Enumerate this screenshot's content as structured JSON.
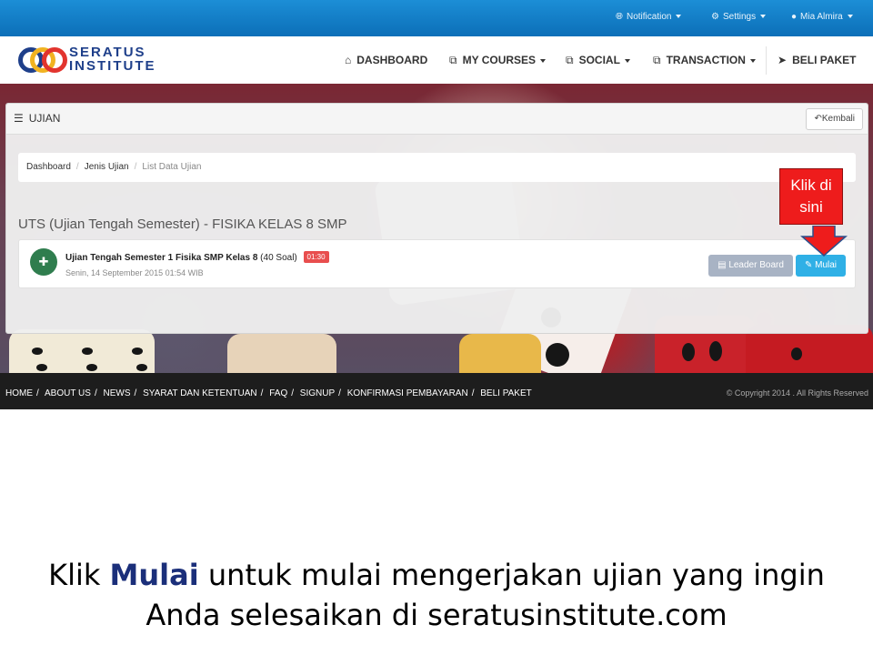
{
  "topbar": {
    "notification": "Notification",
    "settings": "Settings",
    "user": "Mia Almira"
  },
  "logo": {
    "line1": "SERATUS",
    "line2": "INSTITUTE"
  },
  "nav": {
    "dashboard": "DASHBOARD",
    "my_courses": "MY COURSES",
    "social": "SOCIAL",
    "transaction": "TRANSACTION",
    "beli_paket": "BELI PAKET"
  },
  "panel": {
    "title": "UJIAN",
    "back_button": "Kembali"
  },
  "breadcrumb": [
    "Dashboard",
    "Jenis Ujian",
    "List Data Ujian"
  ],
  "section_title": "UTS (Ujian Tengah Semester) - FISIKA KELAS 8 SMP",
  "exam": {
    "title": "Ujian Tengah Semester 1 Fisika SMP Kelas 8",
    "count": "(40 Soal)",
    "duration": "01:30",
    "date": "Senin, 14 September 2015 01:54 WIB",
    "leaderboard_button": "Leader Board",
    "start_button": "Mulai"
  },
  "callout": {
    "line1": "Klik di",
    "line2": "sini"
  },
  "footer": {
    "links": [
      "HOME",
      "ABOUT US",
      "NEWS",
      "SYARAT DAN KETENTUAN",
      "FAQ",
      "SIGNUP",
      "KONFIRMASI PEMBAYARAN",
      "BELI PAKET"
    ],
    "copyright": "© Copyright 2014 . All Rights Reserved"
  },
  "caption": {
    "part1": "Klik ",
    "highlight": "Mulai",
    "part2": " untuk mulai mengerjakan ujian yang ingin",
    "line2": "Anda selesaikan di seratusinstitute.com"
  },
  "colors": {
    "topbar": "#0c6fb8",
    "brand": "#1e3f8a",
    "mulai_button": "#2fb0e6",
    "leaderboard_button": "#a8b3c4",
    "duration_badge": "#e84e4e",
    "callout": "#ee1c1c",
    "footer": "#1d1d1d"
  },
  "icons": {
    "notification": "globe-icon",
    "settings": "gear-icon",
    "user": "user-icon",
    "dashboard": "home-icon",
    "list": "list-icon",
    "back": "reply-icon",
    "exam": "syringe-icon",
    "leaderboard": "bar-chart-icon",
    "start": "edit-icon"
  }
}
